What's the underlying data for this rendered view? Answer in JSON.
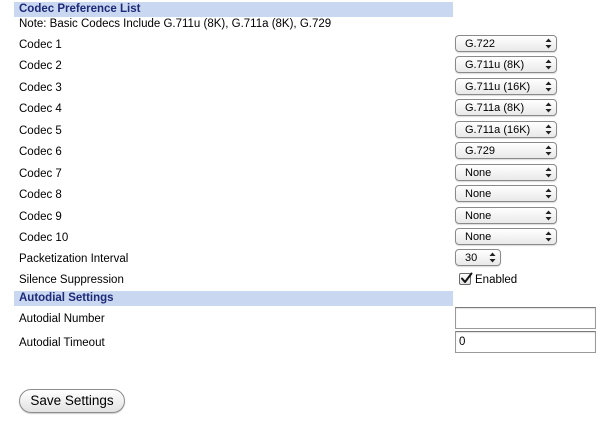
{
  "codec_section": {
    "title": "Codec Preference List",
    "note": "Note: Basic Codecs Include G.711u (8K), G.711a (8K), G.729",
    "codecs": [
      {
        "label": "Codec 1",
        "value": "G.722"
      },
      {
        "label": "Codec 2",
        "value": "G.711u (8K)"
      },
      {
        "label": "Codec 3",
        "value": "G.711u (16K)"
      },
      {
        "label": "Codec 4",
        "value": "G.711a (8K)"
      },
      {
        "label": "Codec 5",
        "value": "G.711a (16K)"
      },
      {
        "label": "Codec 6",
        "value": "G.729"
      },
      {
        "label": "Codec 7",
        "value": "None"
      },
      {
        "label": "Codec 8",
        "value": "None"
      },
      {
        "label": "Codec 9",
        "value": "None"
      },
      {
        "label": "Codec 10",
        "value": "None"
      }
    ],
    "packetization": {
      "label": "Packetization Interval",
      "value": "30"
    },
    "silence_suppression": {
      "label": "Silence Suppression",
      "checkbox_label": "Enabled",
      "checked": true
    }
  },
  "autodial_section": {
    "title": "Autodial Settings",
    "number": {
      "label": "Autodial Number",
      "value": ""
    },
    "timeout": {
      "label": "Autodial Timeout",
      "value": "0"
    }
  },
  "save_button_label": "Save Settings",
  "colors": {
    "section_header_bg": "#c9d7f0",
    "section_header_text": "#1d2a78"
  }
}
